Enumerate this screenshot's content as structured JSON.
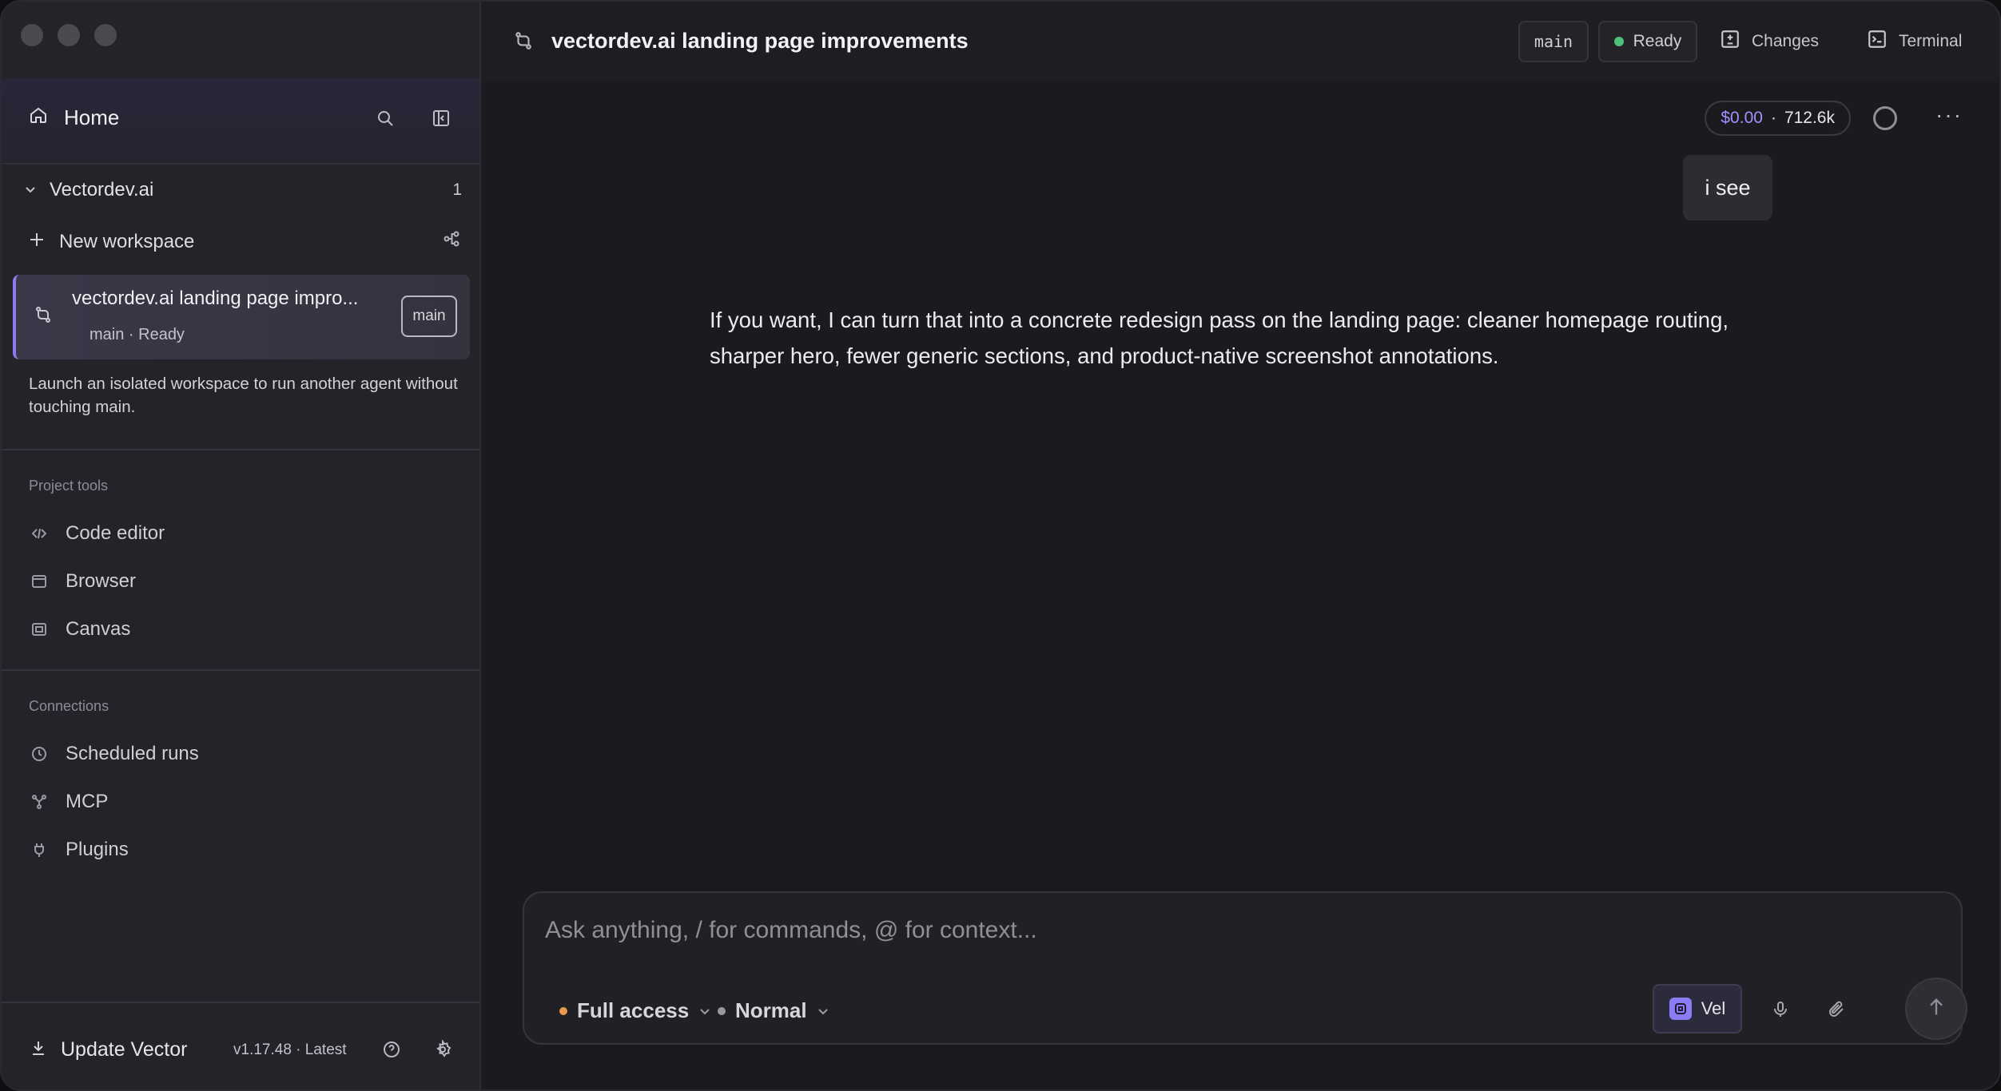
{
  "sidebar": {
    "home_label": "Home",
    "project": {
      "name": "Vectordev.ai",
      "count": "1"
    },
    "new_workspace_label": "New workspace",
    "workspace": {
      "title": "vectordev.ai landing page impro...",
      "subtitle": "main · Ready",
      "branch_badge": "main"
    },
    "hint": "Launch an isolated workspace to run another agent without touching main.",
    "project_tools_label": "Project tools",
    "project_tools": [
      "Code editor",
      "Browser",
      "Canvas"
    ],
    "connections_label": "Connections",
    "connections": [
      "Scheduled runs",
      "MCP",
      "Plugins"
    ],
    "footer": {
      "update_label": "Update Vector",
      "version": "v1.17.48 · Latest"
    }
  },
  "topbar": {
    "title": "vectordev.ai landing page improvements",
    "branch": "main",
    "status": "Ready",
    "status_color": "#4ec07a",
    "changes_label": "Changes",
    "terminal_label": "Terminal"
  },
  "usage": {
    "cost": "$0.00",
    "separator": "·",
    "tokens": "712.6k"
  },
  "chat": {
    "user_message": "i see",
    "assistant_message": "If you want, I can turn that into a concrete redesign pass on the landing page: cleaner homepage routing, sharper hero, fewer generic sections, and product-native screenshot annotations."
  },
  "composer": {
    "placeholder": "Ask anything, / for commands, @ for context...",
    "access_label": "Full access",
    "access_color": "#e89a4a",
    "mode_label": "Normal",
    "mode_color": "#9a9aa3",
    "model_label": "Vel"
  }
}
